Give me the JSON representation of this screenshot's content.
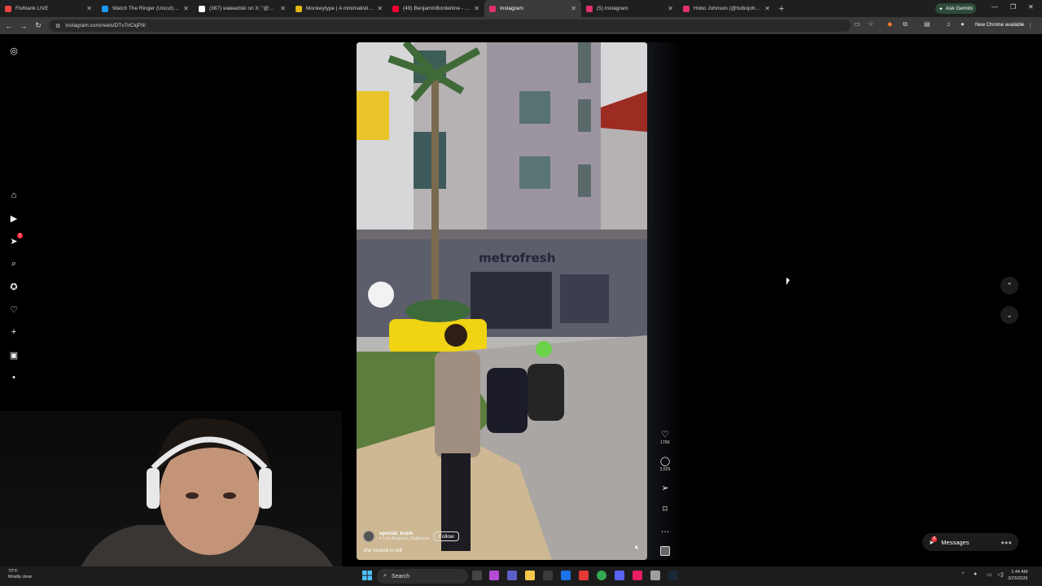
{
  "browser": {
    "tabs": [
      {
        "title": "Fishtank LIVE",
        "favicon_color": "#e44"
      },
      {
        "title": "Watch The Ringer (Uncut) | Prime",
        "favicon_color": "#1a98ff"
      },
      {
        "title": "(367) waleedski on X: \"@Damien",
        "favicon_color": "#fff"
      },
      {
        "title": "Monkeytype | A minimalistic, custo",
        "favicon_color": "#e2b714"
      },
      {
        "title": "(49) BenjaminBorderline - YouTube",
        "favicon_color": "#ff0033"
      },
      {
        "title": "Instagram",
        "favicon_color": "#e1306c",
        "active": true
      },
      {
        "title": "(5) Instagram",
        "favicon_color": "#e1306c"
      },
      {
        "title": "Hobo Johnson (@hobojohnson)",
        "favicon_color": "#e1306c"
      }
    ],
    "ask_gemini": "Ask Gemini",
    "url": "instagram.com/reels/DTv7irCkjP9/",
    "new_chrome": "New Chrome available"
  },
  "sidebar": {
    "items": [
      {
        "name": "instagram-logo-icon",
        "glyph": "◎"
      },
      {
        "name": "home-icon",
        "glyph": "⌂"
      },
      {
        "name": "reels-icon",
        "glyph": "▶"
      },
      {
        "name": "messages-icon",
        "glyph": "➤",
        "badge": "7"
      },
      {
        "name": "search-icon",
        "glyph": "⌕"
      },
      {
        "name": "explore-icon",
        "glyph": "✪"
      },
      {
        "name": "notifications-icon",
        "glyph": "♡"
      },
      {
        "name": "create-icon",
        "glyph": "+"
      },
      {
        "name": "dashboard-icon",
        "glyph": "▣"
      },
      {
        "name": "profile-avatar-icon",
        "glyph": "•"
      },
      {
        "name": "menu-icon",
        "glyph": "≡"
      },
      {
        "name": "also-from-meta-icon",
        "glyph": "⧉"
      }
    ]
  },
  "reel": {
    "username": "special_kram",
    "location": "Los Angeles, California",
    "follow_label": "Follow",
    "caption": "she locked in wtf",
    "storefront": "metrofresh",
    "likes": "176K",
    "comments": "3,529"
  },
  "messages": {
    "label": "Messages",
    "badge": "8"
  },
  "taskbar": {
    "weather_temp": "72°F",
    "weather_desc": "Mostly clear",
    "search_label": "Search",
    "time": "1:44 AM",
    "date": "3/23/2026"
  },
  "colors": {
    "accent": "#e1306c",
    "badge": "#ff3040",
    "background": "#000000"
  }
}
